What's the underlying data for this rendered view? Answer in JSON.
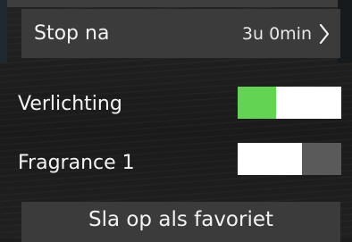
{
  "stop_after": {
    "label": "Stop na",
    "value": "3u 0min",
    "icon": "chevron-right-icon"
  },
  "settings": [
    {
      "label": "Verlichting",
      "state": "on",
      "accent": "#63d353"
    },
    {
      "label": "Fragrance 1",
      "state": "off"
    }
  ],
  "favorite_button": {
    "label": "Sla op als favoriet"
  }
}
